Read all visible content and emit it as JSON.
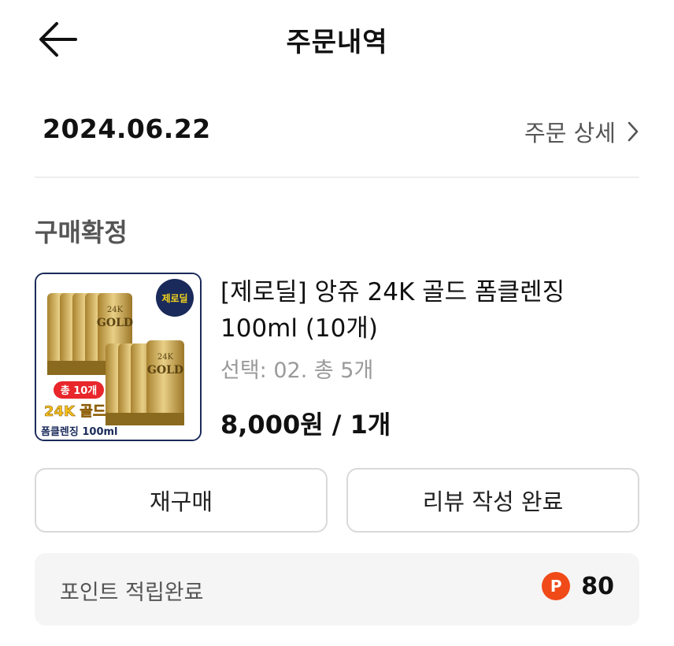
{
  "header": {
    "title": "주문내역"
  },
  "order": {
    "date": "2024.06.22",
    "detail_link": "주문 상세",
    "status": "구매확정"
  },
  "product": {
    "name": "[제로딜] 앙쥬 24K 골드 폼클렌징 100ml (10개)",
    "option": "선택: 02. 총 5개",
    "price": "8,000원 / 1개",
    "image_text": {
      "badge": "제로딜",
      "count": "총 10개",
      "title": "24K 골드",
      "subtitle": "폼클렌징 100ml",
      "tube_brand_top": "24K",
      "tube_brand": "GOLD"
    },
    "image_colors": {
      "gold": "#c8a24a",
      "gold_dark": "#8a6a1e",
      "navy": "#1a2a5a",
      "red": "#e8262b",
      "yellow": "#f6d51c"
    }
  },
  "buttons": {
    "rebuy": "재구매",
    "review": "리뷰 작성 완료"
  },
  "points": {
    "label": "포인트 적립완료",
    "icon_letter": "P",
    "value": "80",
    "icon_color": "#f04a18"
  }
}
